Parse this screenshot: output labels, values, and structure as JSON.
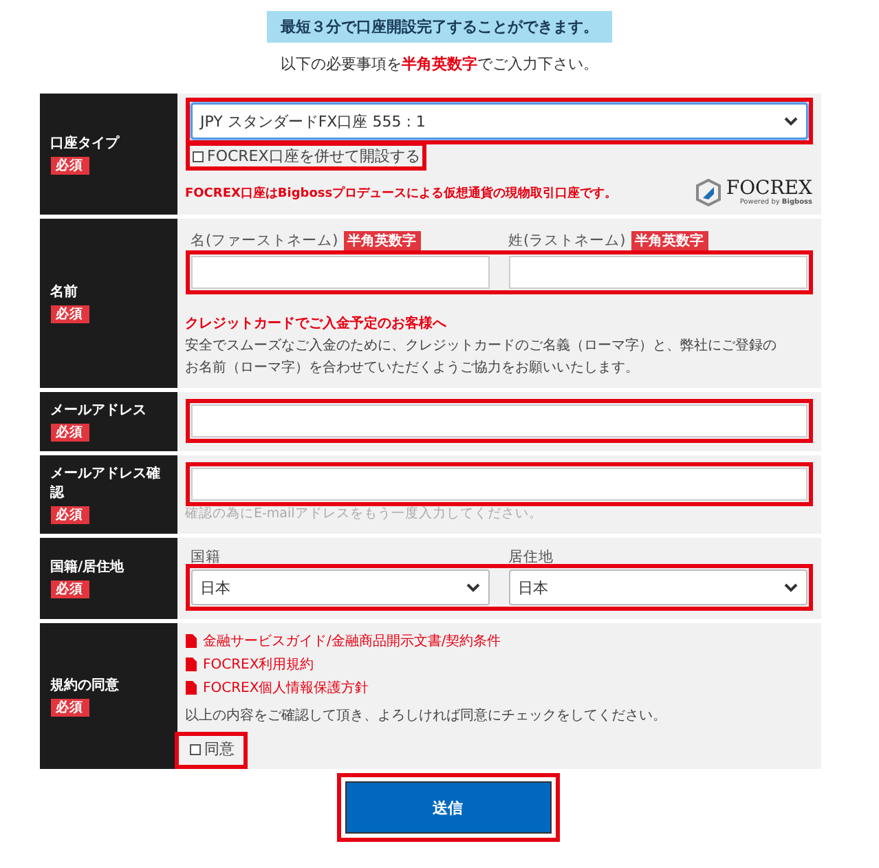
{
  "banner": "最短３分で口座開設完了することができます。",
  "intro": "以下の必要事項を**半角英数字**でご入力下さい。",
  "rows": [
    {
      "kind": "account",
      "label": "口座タイプ",
      "required": "必須",
      "select": {
        "value": "JPY スタンダードFX口座 555 : 1",
        "focused": true,
        "highlighted": true
      },
      "option": {
        "label": "FOCREX口座を併せて開設する",
        "checked": false,
        "highlighted": true
      },
      "note": "FOCREX口座はBigbossプロデュースによる仮想通貨の現物取引口座です。",
      "logo": {
        "name": "FOCREX",
        "powered": "Powered by",
        "brand": "Bigboss"
      }
    },
    {
      "kind": "name",
      "label": "名前",
      "required": "必須",
      "highlighted": true,
      "fields": [
        {
          "label": "名(ファーストネーム)",
          "badge": "半角英数字"
        },
        {
          "label": "姓(ラストネーム)",
          "badge": "半角英数字"
        }
      ],
      "notice_title": "クレジットカードでご入金予定のお客様へ",
      "notice": "安全でスムーズなご入金のために、クレジットカードのご名義（ローマ字）と、弊社にご登録のお名前（ローマ字）を合わせていただくようご協力をお願いいたします。"
    },
    {
      "kind": "input",
      "label": "メールアドレス",
      "required": "必須",
      "highlighted": true
    },
    {
      "kind": "input",
      "label": "メールアドレス確認",
      "required": "必須",
      "highlighted": true,
      "hint": "確認の為にE-mailアドレスをもう一度入力してください。"
    },
    {
      "kind": "selects",
      "label": "国籍/居住地",
      "required": "必須",
      "highlighted": true,
      "fields": [
        {
          "label": "国籍",
          "value": "日本"
        },
        {
          "label": "居住地",
          "value": "日本"
        }
      ]
    },
    {
      "kind": "terms",
      "label": "規約の同意",
      "required": "必須",
      "links": [
        "金融サービスガイド/金融商品開示文書/契約条件",
        "FOCREX利用規約",
        "FOCREX個人情報保護方針"
      ],
      "instruction": "以上の内容をご確認して頂き、よろしければ同意にチェックをしてください。",
      "agree": {
        "label": "同意",
        "checked": false,
        "highlighted": true
      }
    }
  ],
  "submit": {
    "label": "送信",
    "highlighted": true
  }
}
